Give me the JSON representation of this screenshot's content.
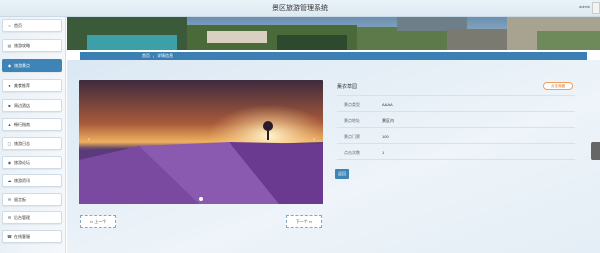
{
  "header": {
    "title": "景区旅游管理系统",
    "user": "admin"
  },
  "sidebar": {
    "items": [
      {
        "label": "首页",
        "icon": "home-icon",
        "glyph": "⌂",
        "active": false
      },
      {
        "label": "旅游攻略",
        "icon": "doc-icon",
        "glyph": "▤",
        "active": false
      },
      {
        "label": "旅游景点",
        "icon": "pin-icon",
        "glyph": "◆",
        "active": true
      },
      {
        "label": "美食推荐",
        "icon": "food-icon",
        "glyph": "●",
        "active": false
      },
      {
        "label": "周边酒店",
        "icon": "hotel-icon",
        "glyph": "■",
        "active": false
      },
      {
        "label": "畅行指南",
        "icon": "guide-icon",
        "glyph": "▲",
        "active": false
      },
      {
        "label": "旅游日志",
        "icon": "log-icon",
        "glyph": "▢",
        "active": false
      },
      {
        "label": "旅游论坛",
        "icon": "forum-icon",
        "glyph": "◉",
        "active": false
      },
      {
        "label": "旅游资讯",
        "icon": "news-icon",
        "glyph": "☁",
        "active": false
      },
      {
        "label": "留言板",
        "icon": "message-icon",
        "glyph": "✉",
        "active": false
      },
      {
        "label": "后台管理",
        "icon": "admin-icon",
        "glyph": "⚙",
        "active": false
      },
      {
        "label": "在线客服",
        "icon": "service-icon",
        "glyph": "☎",
        "active": false
      }
    ]
  },
  "breadcrumb": {
    "home": "首页",
    "separator": "/",
    "current": "详情信息"
  },
  "detail": {
    "name": "薰衣草园",
    "favorite_label": "点击收藏",
    "fields": [
      {
        "key": "景点类型",
        "value": "AAAA"
      },
      {
        "key": "景点地址",
        "value": "景区内"
      },
      {
        "key": "景点门票",
        "value": "100"
      },
      {
        "key": "点击次数",
        "value": "1"
      }
    ],
    "back_label": "返回"
  },
  "carousel": {
    "prev_label": "上一个",
    "next_label": "下一个",
    "prev_arrow": "‹",
    "next_arrow": "›"
  },
  "pager": {
    "prev_label": "⇦ 上一个",
    "next_label": "下一个 ⇨"
  },
  "colors": {
    "accent": "#3f84b7",
    "favorite": "#e07020"
  }
}
